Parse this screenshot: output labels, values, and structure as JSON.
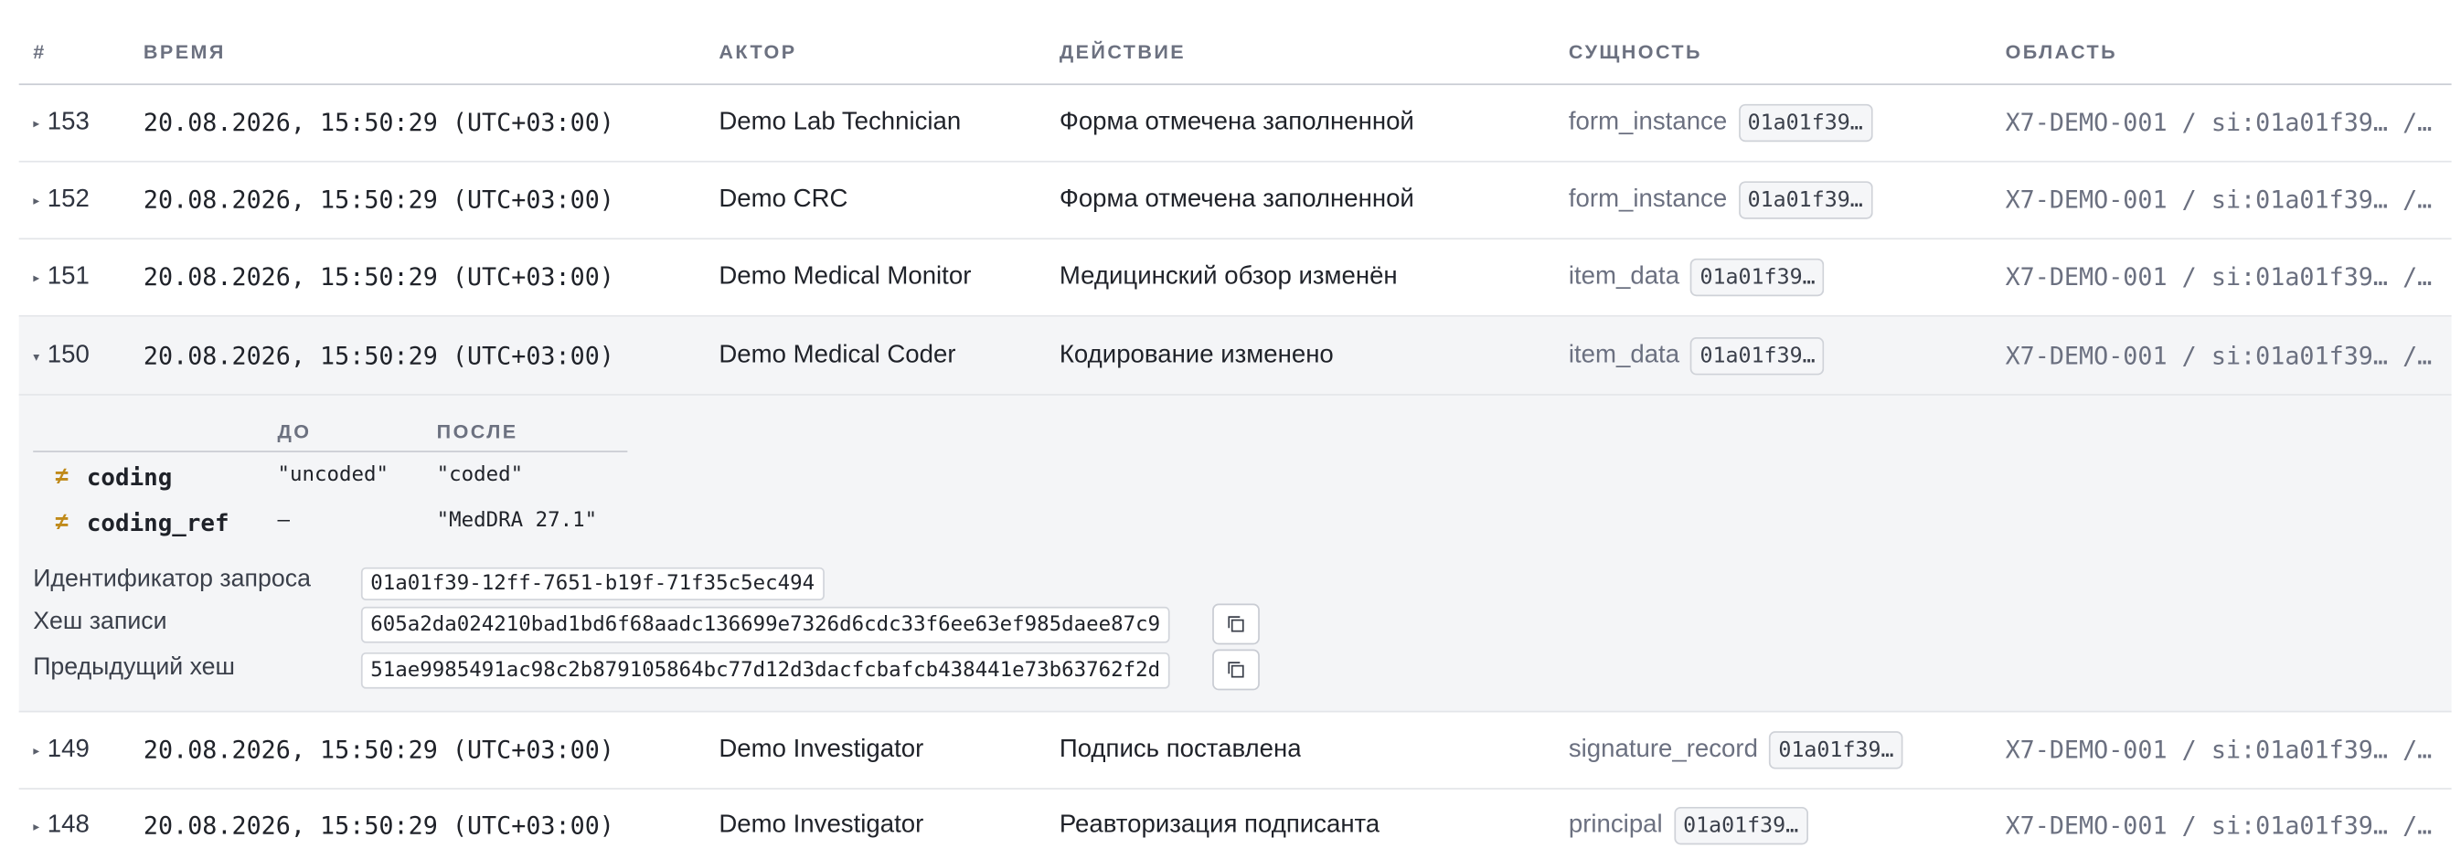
{
  "columns": [
    "#",
    "ВРЕМЯ",
    "АКТОР",
    "ДЕЙСТВИЕ",
    "СУЩНОСТЬ",
    "ОБЛАСТЬ"
  ],
  "rows": [
    {
      "id": "153",
      "expanded": false,
      "time": "20.08.2026, 15:50:29 (UTC+03:00)",
      "actor": "Demo Lab Technician",
      "action": "Форма отмечена заполненной",
      "entity": "form_instance",
      "entity_id": "01a01f39…",
      "scope": "X7-DEMO-001 / si:01a01f39… /…"
    },
    {
      "id": "152",
      "expanded": false,
      "time": "20.08.2026, 15:50:29 (UTC+03:00)",
      "actor": "Demo CRC",
      "action": "Форма отмечена заполненной",
      "entity": "form_instance",
      "entity_id": "01a01f39…",
      "scope": "X7-DEMO-001 / si:01a01f39… /…"
    },
    {
      "id": "151",
      "expanded": false,
      "time": "20.08.2026, 15:50:29 (UTC+03:00)",
      "actor": "Demo Medical Monitor",
      "action": "Медицинский обзор изменён",
      "entity": "item_data",
      "entity_id": "01a01f39…",
      "scope": "X7-DEMO-001 / si:01a01f39… /…"
    },
    {
      "id": "150",
      "expanded": true,
      "time": "20.08.2026, 15:50:29 (UTC+03:00)",
      "actor": "Demo Medical Coder",
      "action": "Кодирование изменено",
      "entity": "item_data",
      "entity_id": "01a01f39…",
      "scope": "X7-DEMO-001 / si:01a01f39… /…"
    },
    {
      "id": "149",
      "expanded": false,
      "time": "20.08.2026, 15:50:29 (UTC+03:00)",
      "actor": "Demo Investigator",
      "action": "Подпись поставлена",
      "entity": "signature_record",
      "entity_id": "01a01f39…",
      "scope": "X7-DEMO-001 / si:01a01f39… /…"
    },
    {
      "id": "148",
      "expanded": false,
      "time": "20.08.2026, 15:50:29 (UTC+03:00)",
      "actor": "Demo Investigator",
      "action": "Реавторизация подписанта",
      "entity": "principal",
      "entity_id": "01a01f39…",
      "scope": "X7-DEMO-001 / si:01a01f39… /…"
    }
  ],
  "toggle": {
    "collapsed": "▸",
    "expanded": "▾"
  },
  "detail": {
    "before_label": "ДО",
    "after_label": "ПОСЛЕ",
    "changed_marker": "≠",
    "diff": [
      {
        "field": "coding",
        "before": "\"uncoded\"",
        "after": "\"coded\""
      },
      {
        "field": "coding_ref",
        "before": "—",
        "after": "\"MedDRA 27.1\""
      }
    ],
    "request_id_label": "Идентификатор запроса",
    "request_id": "01a01f39-12ff-7651-b19f-71f35c5ec494",
    "record_hash_label": "Хеш записи",
    "record_hash": "605a2da024210bad1bd6f68aadc136699e7326d6cdc33f6ee63ef985daee87c9",
    "prev_hash_label": "Предыдущий хеш",
    "prev_hash": "51ae9985491ac98c2b879105864bc77d12d3dacfcbafcb438441e73b63762f2d"
  },
  "icons": {
    "copy": "copy-icon",
    "toggle": "triangle-toggle-icon"
  },
  "colors": {
    "accent_changed": "#c08a1a",
    "expanded_bg": "#f4f5f7",
    "muted_text": "#6b7080"
  }
}
